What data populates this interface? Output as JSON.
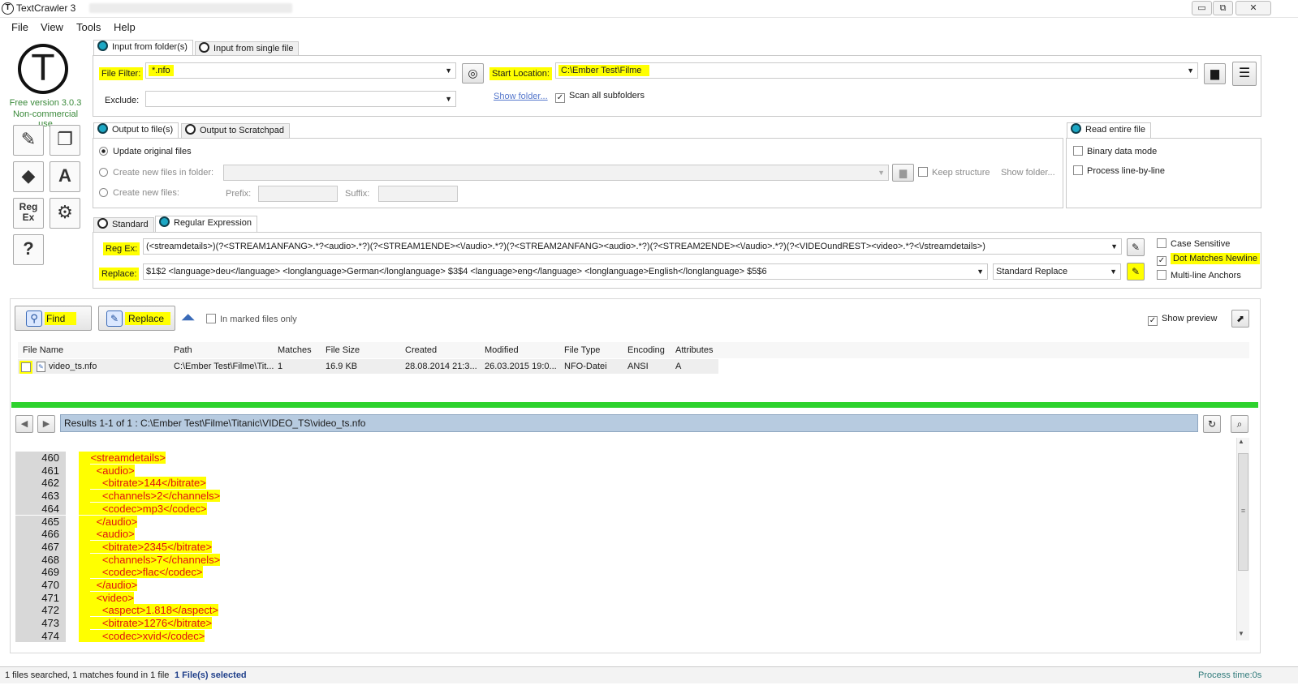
{
  "window": {
    "title": "TextCrawler 3",
    "minimize": "▭",
    "restore": "⧉",
    "close": "✕"
  },
  "menu": [
    "File",
    "View",
    "Tools",
    "Help"
  ],
  "branding": {
    "logo_letter": "T",
    "version": "Free version 3.0.3",
    "license": "Non-commercial use"
  },
  "sidebar_tools": [
    {
      "icon": "edit-icon",
      "glyph": "✎"
    },
    {
      "icon": "windows-icon",
      "glyph": "❐"
    },
    {
      "icon": "book-icon",
      "glyph": "◆"
    },
    {
      "icon": "font-icon",
      "glyph": "A"
    },
    {
      "icon": "regex-icon",
      "glyph": "Reg Ex"
    },
    {
      "icon": "settings-icon",
      "glyph": "⚙"
    },
    {
      "icon": "help-icon",
      "glyph": "?"
    }
  ],
  "input": {
    "tab_folder": "Input from folder(s)",
    "tab_single": "Input from single file",
    "file_filter_label": "File Filter:",
    "file_filter_value": "*.nfo",
    "exclude_label": "Exclude:",
    "exclude_value": "",
    "start_location_label": "Start Location:",
    "start_location_value": "C:\\Ember Test\\Filme",
    "show_folder": "Show folder...",
    "scan_subfolders": "Scan all subfolders",
    "scan_subfolders_checked": true
  },
  "output": {
    "tab_files": "Output to file(s)",
    "tab_scratchpad": "Output to Scratchpad",
    "update_original": "Update original files",
    "create_in_folder": "Create new files in folder:",
    "create_new": "Create new files:",
    "prefix_label": "Prefix:",
    "suffix_label": "Suffix:",
    "keep_structure": "Keep structure",
    "show_folder": "Show folder..."
  },
  "read_options": {
    "tab": "Read entire file",
    "binary": "Binary data mode",
    "line_by_line": "Process line-by-line"
  },
  "regex": {
    "tab_standard": "Standard",
    "tab_regex": "Regular Expression",
    "regex_label": "Reg Ex:",
    "regex_value": "(<streamdetails>)(?<STREAM1ANFANG>.*?<audio>.*?)(?<STREAM1ENDE><\\/audio>.*?)(?<STREAM2ANFANG><audio>.*?)(?<STREAM2ENDE><\\/audio>.*?)(?<VIDEOundREST><video>.*?<\\/streamdetails>)",
    "replace_label": "Replace:",
    "replace_value": "$1$2  <language>deu</language>       <longlanguage>German</longlanguage>     $3$4  <language>eng</language>       <longlanguage>English</longlanguage>     $5$6",
    "replace_mode": "Standard Replace",
    "case_sensitive": "Case Sensitive",
    "dot_newline": "Dot Matches Newline",
    "dot_newline_checked": true,
    "multiline": "Multi-line Anchors"
  },
  "actions": {
    "find": "Find",
    "replace": "Replace",
    "marked_only": "In marked files only",
    "show_preview": "Show preview",
    "show_preview_checked": true
  },
  "results_table": {
    "headers": [
      "File Name",
      "Path",
      "Matches",
      "File Size",
      "Created",
      "Modified",
      "File Type",
      "Encoding",
      "Attributes"
    ],
    "rows": [
      [
        "video_ts.nfo",
        "C:\\Ember Test\\Filme\\Tit...",
        "1",
        "16.9 KB",
        "28.08.2014 21:3...",
        "26.03.2015 19:0...",
        "NFO-Datei",
        "ANSI",
        "A"
      ]
    ]
  },
  "progress": {
    "fraction": 1.0,
    "color": "#2dd22d"
  },
  "preview": {
    "results_text": "Results 1-1 of 1 : C:\\Ember Test\\Filme\\Titanic\\VIDEO_TS\\video_ts.nfo",
    "prev": "◀",
    "next": "▶",
    "lines": [
      {
        "n": "460",
        "text": "<streamdetails>",
        "indent": 2
      },
      {
        "n": "461",
        "text": "<audio>",
        "indent": 3
      },
      {
        "n": "462",
        "text": "<bitrate>144</bitrate>",
        "indent": 4
      },
      {
        "n": "463",
        "text": "<channels>2</channels>",
        "indent": 4
      },
      {
        "n": "464",
        "text": "<codec>mp3</codec>",
        "indent": 4
      },
      {
        "n": "465",
        "text": "</audio>",
        "indent": 3
      },
      {
        "n": "466",
        "text": "<audio>",
        "indent": 3
      },
      {
        "n": "467",
        "text": "<bitrate>2345</bitrate>",
        "indent": 4
      },
      {
        "n": "468",
        "text": "<channels>7</channels>",
        "indent": 4
      },
      {
        "n": "469",
        "text": "<codec>flac</codec>",
        "indent": 4
      },
      {
        "n": "470",
        "text": "</audio>",
        "indent": 3
      },
      {
        "n": "471",
        "text": "<video>",
        "indent": 3
      },
      {
        "n": "472",
        "text": "<aspect>1.818</aspect>",
        "indent": 4
      },
      {
        "n": "473",
        "text": "<bitrate>1276</bitrate>",
        "indent": 4
      },
      {
        "n": "474",
        "text": "<codec>xvid</codec>",
        "indent": 4
      }
    ]
  },
  "status": {
    "summary": "1 files searched, 1 matches found in 1 file",
    "selected": "1 File(s) selected",
    "process_time": "Process time:0s"
  },
  "colors": {
    "accent_radio": "#1ca7c4",
    "highlight": "#ffff00",
    "match_text": "#e01010",
    "results_bar": "#b7cbe0",
    "version_green": "#3b8a3b"
  }
}
